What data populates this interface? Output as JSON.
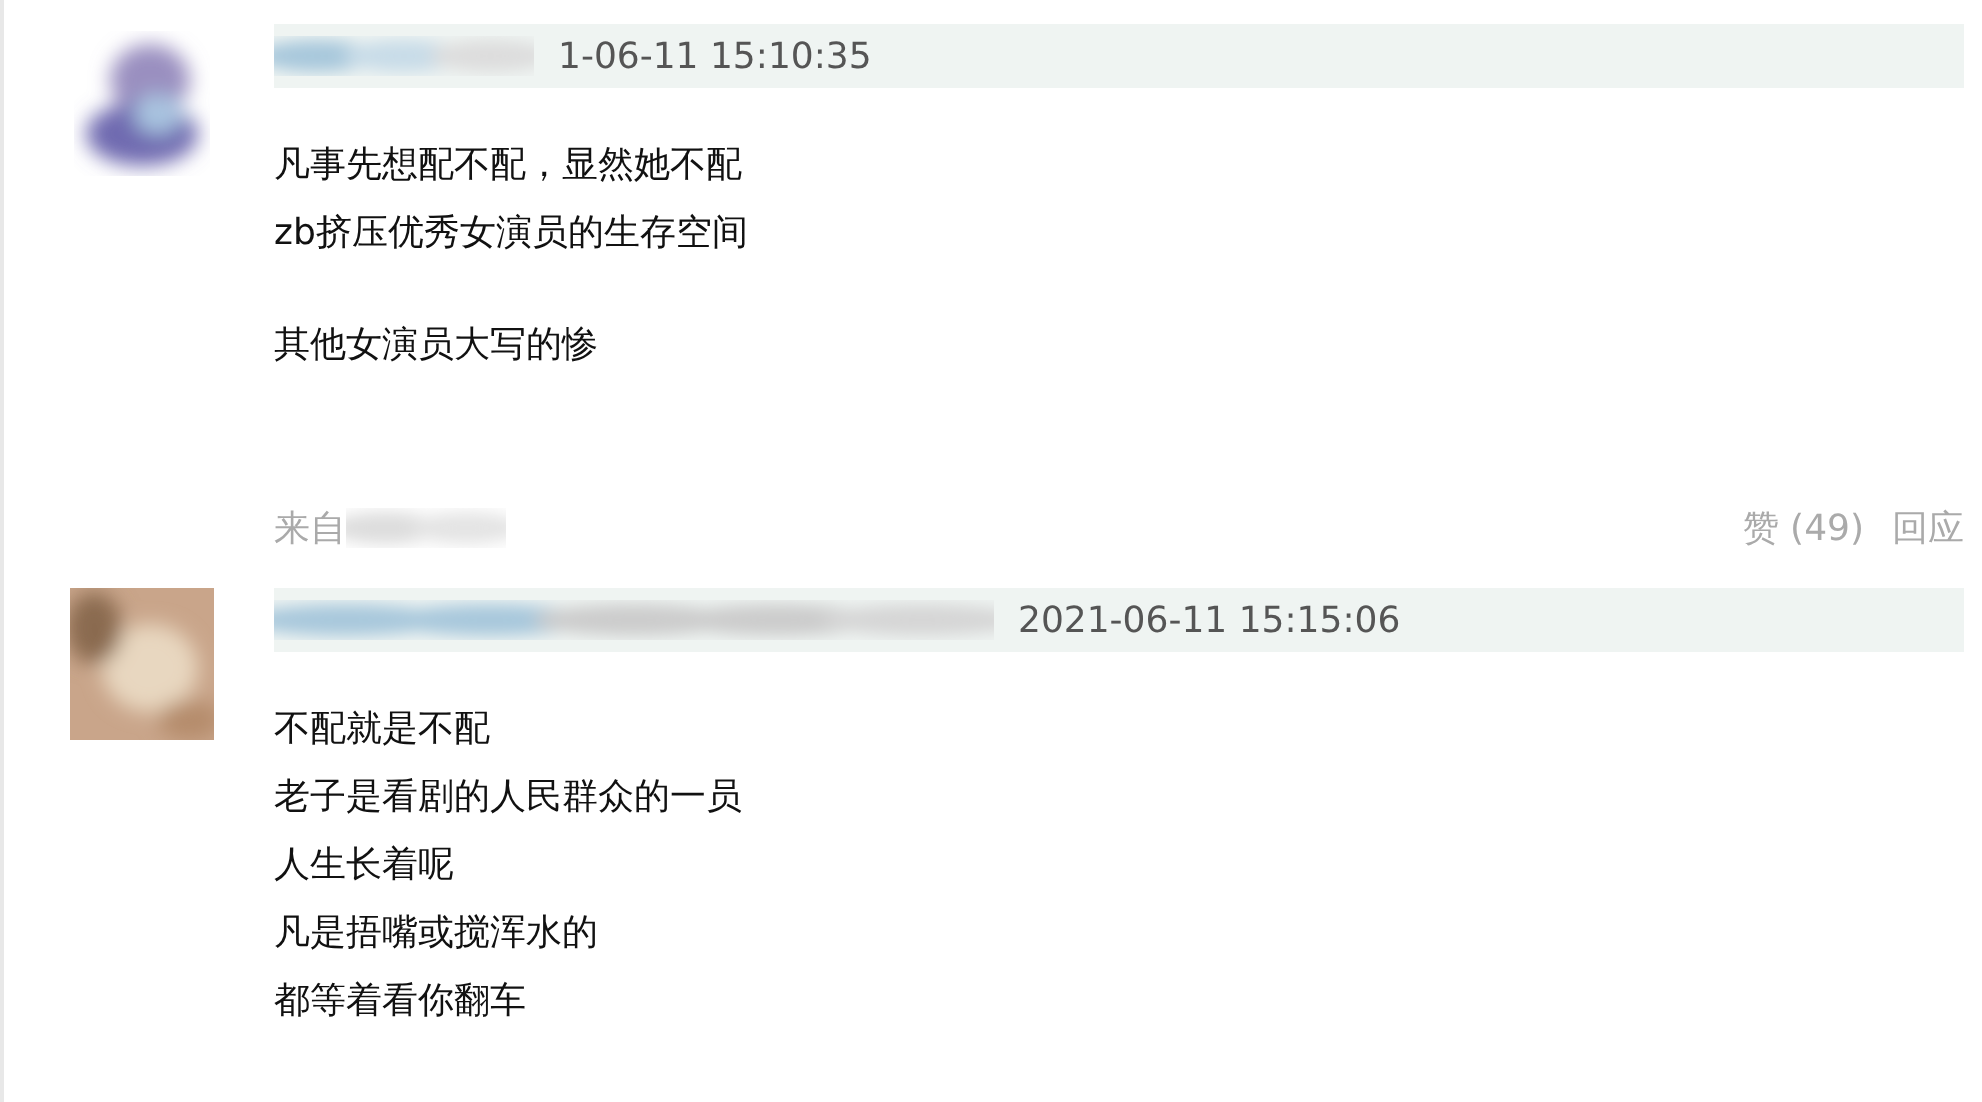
{
  "comments": [
    {
      "time": "1-06-11 15:10:35",
      "paragraphs": [
        [
          "凡事先想配不配，显然她不配",
          "zb挤压优秀女演员的生存空间"
        ],
        [
          "其他女演员大写的惨"
        ]
      ],
      "footer": {
        "source": "来自",
        "likes": "赞 (49)",
        "reply": "回应"
      }
    },
    {
      "time": "2021-06-11 15:15:06",
      "paragraphs": [
        [
          "不配就是不配",
          "老子是看剧的人民群众的一员",
          "人生长着呢",
          "凡是捂嘴或搅浑水的",
          "都等着看你翻车"
        ]
      ]
    }
  ]
}
